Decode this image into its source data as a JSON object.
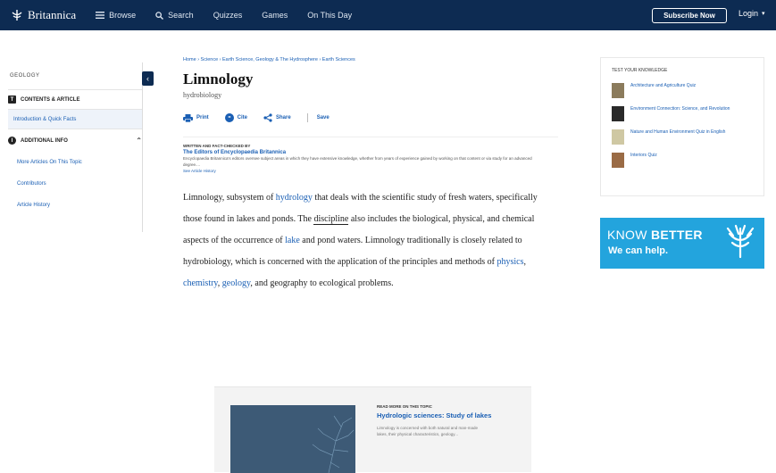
{
  "nav": {
    "brand": "Britannica",
    "items": [
      {
        "icon": "grid-icon",
        "label": "Browse"
      },
      {
        "icon": "search-icon",
        "label": "Search"
      },
      {
        "icon": "",
        "label": "Quizzes"
      },
      {
        "icon": "",
        "label": "Games"
      },
      {
        "icon": "",
        "label": "On This Day"
      }
    ],
    "subscribe": "Subscribe Now",
    "login": "Login"
  },
  "sidebar": {
    "heading": "Geology",
    "sections": [
      {
        "badge": "T",
        "title": "Contents & Article",
        "links": [
          {
            "label": "Introduction & Quick Facts",
            "active": true
          }
        ]
      },
      {
        "badge": "i",
        "title": "Additional Info",
        "links": [
          {
            "label": "More Articles On This Topic"
          },
          {
            "label": "Contributors"
          },
          {
            "label": "Article History"
          }
        ]
      }
    ]
  },
  "breadcrumb": "Home › Science › Earth Science, Geology & The Hydrosphere › Earth Sciences",
  "article": {
    "title": "Limnology",
    "subtitle": "hydrobiology",
    "actions": [
      "Print",
      "Cite",
      "Share",
      "Save"
    ],
    "written_by_label": "Written and fact-checked by",
    "author": "The Editors of Encyclopaedia Britannica",
    "author_desc": "Encyclopaedia Britannica's editors oversee subject areas in which they have extensive knowledge, whether from years of experience gained by working on that content or via study for an advanced degree....",
    "history_link": "See Article History",
    "body": [
      {
        "t": "Limnology, subsystem of "
      },
      {
        "t": "hydrology",
        "link": true
      },
      {
        "t": " that deals with the scientific study of fresh waters, specifically those found in lakes and ponds. The "
      },
      {
        "t": "discipline",
        "underline": true
      },
      {
        "t": " also includes the biological, physical, and chemical aspects of the occurrence of "
      },
      {
        "t": "lake",
        "link": true
      },
      {
        "t": " and pond waters. Limnology traditionally is closely related to hydrobiology, which is concerned with the application of the principles and methods of "
      },
      {
        "t": "physics",
        "link": true
      },
      {
        "t": ", "
      },
      {
        "t": "chemistry",
        "link": true
      },
      {
        "t": ", "
      },
      {
        "t": "geology",
        "link": true
      },
      {
        "t": ", and geography to ecological problems."
      }
    ]
  },
  "read_more": {
    "label": "Read More on This Topic",
    "title": "Hydrologic sciences: Study of lakes",
    "desc": "Limnology is concerned with both natural and man-made lakes, their physical characteristics, geology..."
  },
  "quiz": {
    "heading": "Test Your Knowledge",
    "items": [
      {
        "label": "Architecture and Agriculture Quiz",
        "thumb_color": "#8b7b5c"
      },
      {
        "label": "Environment Connection: Science, and Revolution",
        "thumb_color": "#2a2a2a"
      },
      {
        "label": "Nature and Human Environment Quiz in English",
        "thumb_color": "#cfc8a3"
      },
      {
        "label": "Interiors Quiz",
        "thumb_color": "#9a6b45"
      }
    ]
  },
  "ad": {
    "line1a": "KNOW",
    "line1b": "BETTER",
    "line2": "We can help."
  }
}
